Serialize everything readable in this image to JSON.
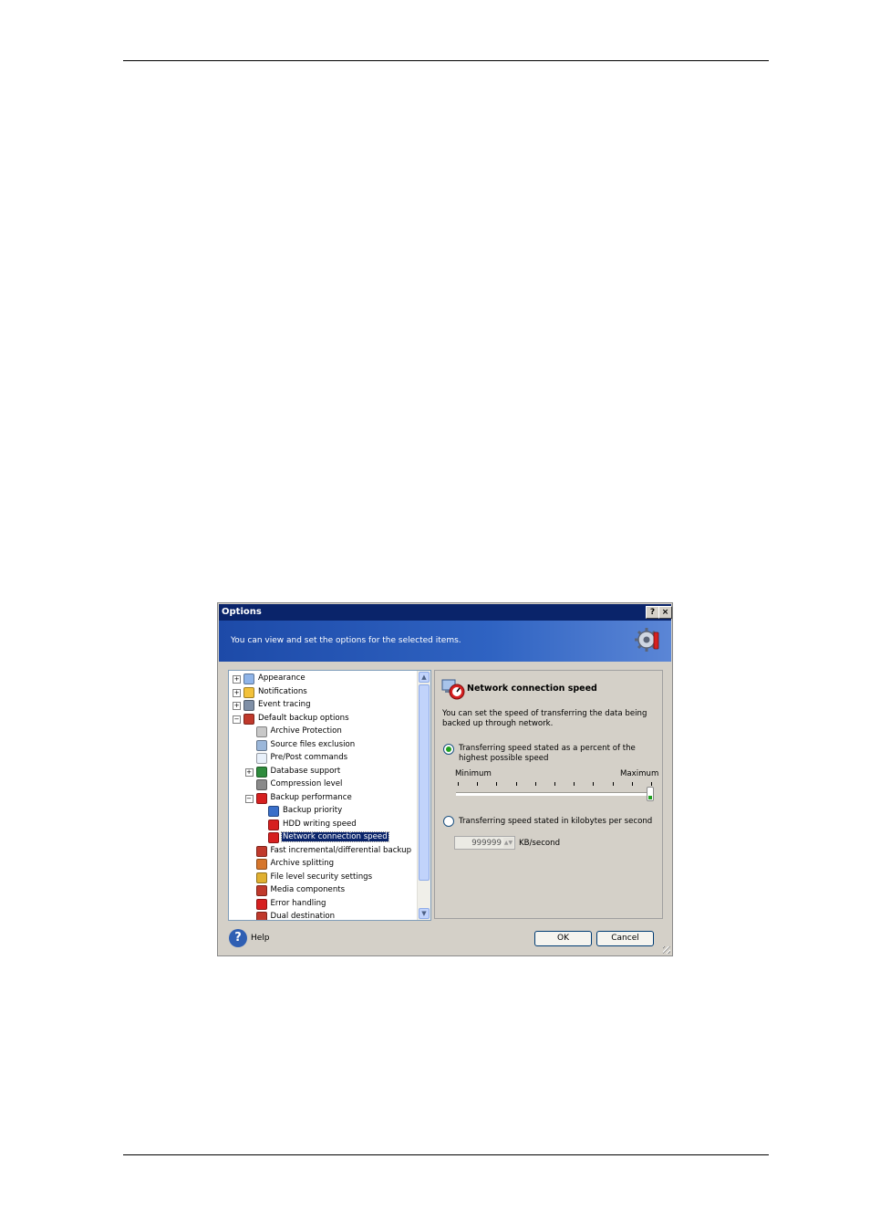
{
  "dialog": {
    "title": "Options",
    "help_glyph": "?",
    "close_glyph": "×",
    "banner_text": "You can view and set the options for the selected items.",
    "banner_icon": "gear-icon"
  },
  "tree": {
    "items": [
      {
        "label": "Appearance",
        "expander": "+",
        "level": 0,
        "icon": "appearance-icon",
        "icon_color": "#8fb4e8"
      },
      {
        "label": "Notifications",
        "expander": "+",
        "level": 0,
        "icon": "notifications-icon",
        "icon_color": "#f2c13a"
      },
      {
        "label": "Event tracing",
        "expander": "+",
        "level": 0,
        "icon": "event-tracing-icon",
        "icon_color": "#7f8fa6"
      },
      {
        "label": "Default backup options",
        "expander": "−",
        "level": 0,
        "icon": "backup-options-icon",
        "icon_color": "#c0392b"
      },
      {
        "label": "Archive Protection",
        "expander": "",
        "level": 1,
        "icon": "lock-icon",
        "icon_color": "#c8c8c8"
      },
      {
        "label": "Source files exclusion",
        "expander": "",
        "level": 1,
        "icon": "exclusion-icon",
        "icon_color": "#9bb7da"
      },
      {
        "label": "Pre/Post commands",
        "expander": "",
        "level": 1,
        "icon": "commands-icon",
        "icon_color": "#e8f0fa"
      },
      {
        "label": "Database support",
        "expander": "+",
        "level": 1,
        "icon": "shield-icon",
        "icon_color": "#2e8b3d"
      },
      {
        "label": "Compression level",
        "expander": "",
        "level": 1,
        "icon": "compression-icon",
        "icon_color": "#8a8a8a"
      },
      {
        "label": "Backup performance",
        "expander": "−",
        "level": 1,
        "icon": "performance-icon",
        "icon_color": "#d62020"
      },
      {
        "label": "Backup priority",
        "expander": "",
        "level": 2,
        "icon": "priority-icon",
        "icon_color": "#3a6fc9"
      },
      {
        "label": "HDD writing speed",
        "expander": "",
        "level": 2,
        "icon": "hdd-speed-icon",
        "icon_color": "#d62020"
      },
      {
        "label": "Network connection speed",
        "expander": "",
        "level": 2,
        "icon": "network-speed-icon",
        "icon_color": "#d62020",
        "selected": true
      },
      {
        "label": "Fast incremental/differential backup",
        "expander": "",
        "level": 1,
        "icon": "fast-backup-icon",
        "icon_color": "#c0392b"
      },
      {
        "label": "Archive splitting",
        "expander": "",
        "level": 1,
        "icon": "splitting-icon",
        "icon_color": "#d6762b"
      },
      {
        "label": "File level security settings",
        "expander": "",
        "level": 1,
        "icon": "security-icon",
        "icon_color": "#e0b030"
      },
      {
        "label": "Media components",
        "expander": "",
        "level": 1,
        "icon": "media-icon",
        "icon_color": "#c0392b"
      },
      {
        "label": "Error handling",
        "expander": "",
        "level": 1,
        "icon": "error-icon",
        "icon_color": "#d62020"
      },
      {
        "label": "Dual destination",
        "expander": "",
        "level": 1,
        "icon": "dual-destination-icon",
        "icon_color": "#c0392b"
      }
    ]
  },
  "panel": {
    "title": "Network connection speed",
    "title_icon": "network-speed-icon",
    "description": "You can set the speed of transferring the data being backed up through network.",
    "option_percent": "Transferring speed stated as a percent of the highest possible speed",
    "option_percent_selected": true,
    "slider_min_label": "Minimum",
    "slider_max_label": "Maximum",
    "slider_value_fraction": 1.0,
    "option_kbps": "Transferring speed stated in kilobytes per second",
    "option_kbps_selected": false,
    "kbps_value": "999999",
    "kbps_unit": "KB/second"
  },
  "footer": {
    "help_label": "Help",
    "ok_label": "OK",
    "cancel_label": "Cancel"
  }
}
